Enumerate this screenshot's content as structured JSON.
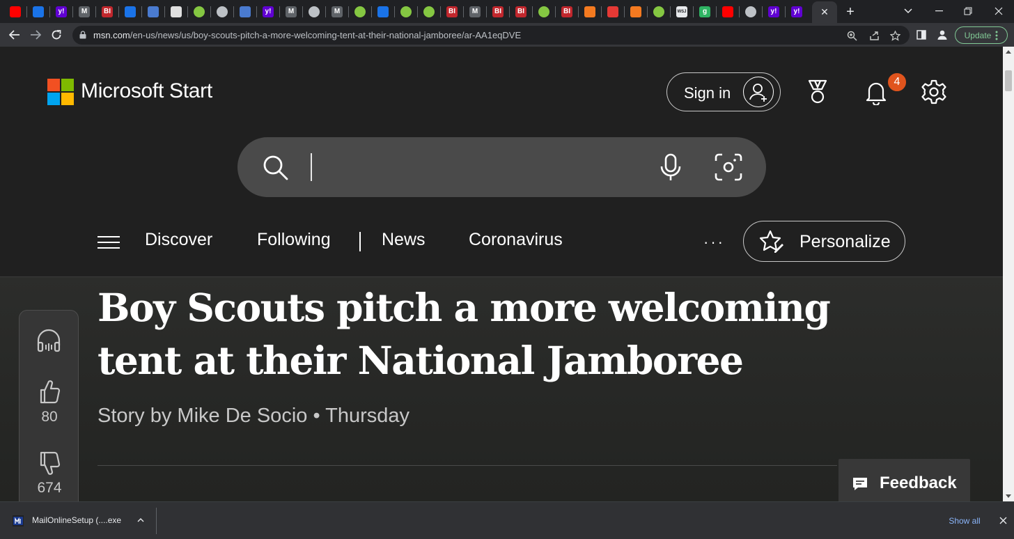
{
  "browser": {
    "tabs": [
      {
        "icon": "youtube-icon",
        "label": "",
        "color": "#ff0000"
      },
      {
        "icon": "shield-icon",
        "label": "",
        "color": "#1a73e8"
      },
      {
        "icon": "yahoo-icon",
        "label": "y!",
        "color": "#6001d2"
      },
      {
        "icon": "news-icon",
        "label": "M",
        "color": "#5f6368"
      },
      {
        "icon": "business-insider-icon",
        "label": "BI",
        "color": "#c1272d"
      },
      {
        "icon": "shield-icon",
        "label": "",
        "color": "#1a73e8"
      },
      {
        "icon": "play-arrow-icon",
        "label": "",
        "color": "#4a7bd0"
      },
      {
        "icon": "puzzle-icon",
        "label": "",
        "color": "#e0e0e0"
      },
      {
        "icon": "rumble-icon",
        "label": "",
        "color": "#85c742"
      },
      {
        "icon": "globe-icon",
        "label": "",
        "color": "#bdc1c6"
      },
      {
        "icon": "play-arrow-icon",
        "label": "",
        "color": "#4a7bd0"
      },
      {
        "icon": "yahoo-icon",
        "label": "y!",
        "color": "#6001d2"
      },
      {
        "icon": "news-icon",
        "label": "M",
        "color": "#5f6368"
      },
      {
        "icon": "globe-icon",
        "label": "",
        "color": "#bdc1c6"
      },
      {
        "icon": "news-icon",
        "label": "M",
        "color": "#5f6368"
      },
      {
        "icon": "rumble-icon",
        "label": "",
        "color": "#85c742"
      },
      {
        "icon": "shield-icon",
        "label": "",
        "color": "#1a73e8"
      },
      {
        "icon": "rumble-icon",
        "label": "",
        "color": "#85c742"
      },
      {
        "icon": "rumble-icon",
        "label": "",
        "color": "#85c742"
      },
      {
        "icon": "business-insider-icon",
        "label": "BI",
        "color": "#c1272d"
      },
      {
        "icon": "news-icon",
        "label": "M",
        "color": "#5f6368"
      },
      {
        "icon": "business-insider-icon",
        "label": "BI",
        "color": "#c1272d"
      },
      {
        "icon": "business-insider-icon",
        "label": "BI",
        "color": "#c1272d"
      },
      {
        "icon": "rumble-icon",
        "label": "",
        "color": "#85c742"
      },
      {
        "icon": "business-insider-icon",
        "label": "BI",
        "color": "#c1272d"
      },
      {
        "icon": "bookmark-icon",
        "label": "",
        "color": "#f47a20"
      },
      {
        "icon": "podcast-icon",
        "label": "",
        "color": "#e53935"
      },
      {
        "icon": "bookmark-icon",
        "label": "",
        "color": "#f47a20"
      },
      {
        "icon": "rumble-icon",
        "label": "",
        "color": "#85c742"
      },
      {
        "icon": "wsj-icon",
        "label": "WSJ",
        "color": "#e8eaed"
      },
      {
        "icon": "g-icon",
        "label": "g",
        "color": "#2fb463"
      },
      {
        "icon": "youtube-icon",
        "label": "",
        "color": "#ff0000"
      },
      {
        "icon": "globe-icon",
        "label": "",
        "color": "#bdc1c6"
      },
      {
        "icon": "yahoo-icon",
        "label": "y!",
        "color": "#6001d2"
      },
      {
        "icon": "yahoo-icon",
        "label": "y!",
        "color": "#6001d2"
      }
    ],
    "active_tab_close": "✕",
    "new_tab": "+",
    "url_host": "msn.com",
    "url_path": "/en-us/news/us/boy-scouts-pitch-a-more-welcoming-tent-at-their-national-jamboree/ar-AA1eqDVE",
    "update_label": "Update"
  },
  "header": {
    "brand": "Microsoft Start",
    "sign_in": "Sign in",
    "notification_count": "4",
    "logo_colors": [
      "#f25022",
      "#7fba00",
      "#00a4ef",
      "#ffb900"
    ]
  },
  "search": {
    "placeholder": ""
  },
  "nav": {
    "items": [
      "Discover",
      "Following",
      "News",
      "Coronavirus"
    ],
    "more": "···",
    "personalize": "Personalize"
  },
  "article": {
    "headline": "Boy Scouts pitch a more welcoming tent at their National Jamboree",
    "byline": "Story by Mike De Socio • Thursday",
    "likes": "80",
    "dislikes": "674"
  },
  "feedback": {
    "label": "Feedback"
  },
  "downloads": {
    "file_name": "MailOnlineSetup (....exe",
    "show_all": "Show all"
  }
}
